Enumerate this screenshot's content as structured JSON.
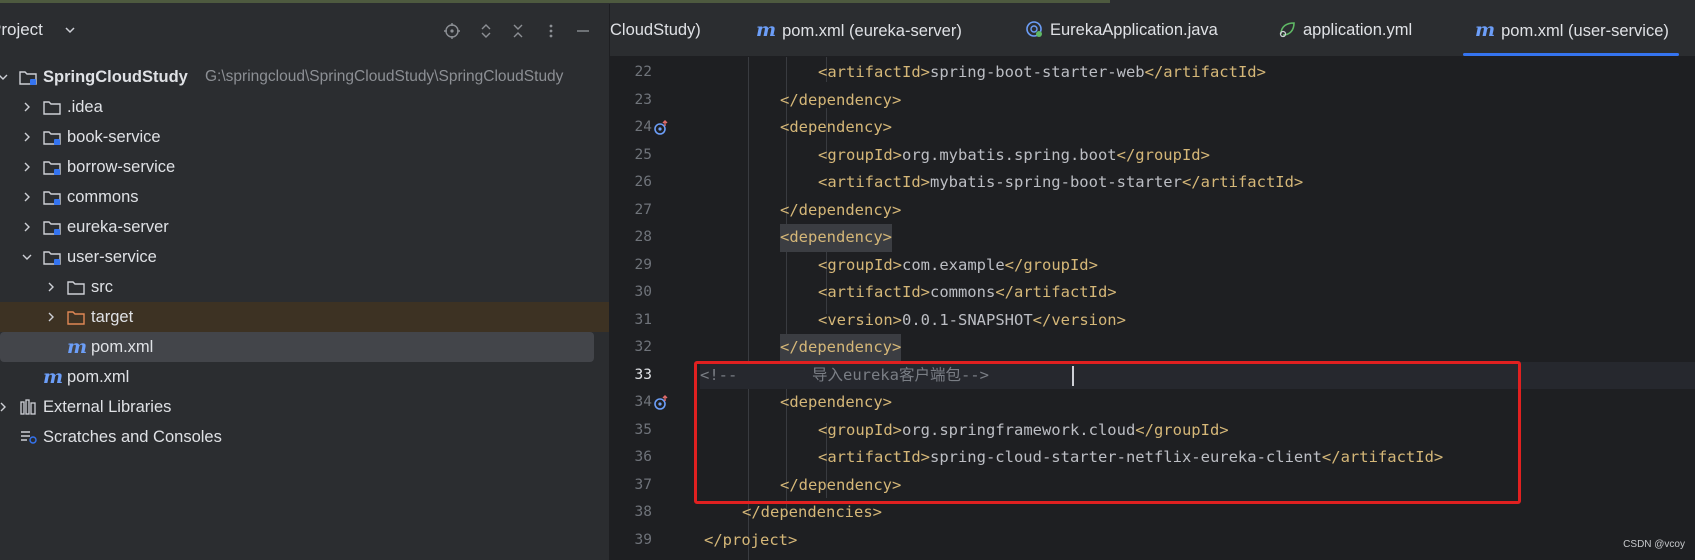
{
  "project_panel": {
    "title": "Project",
    "tree": [
      {
        "label": "SpringCloudStudy",
        "path": "G:\\springcloud\\SpringCloudStudy\\SpringCloudStudy",
        "icon": "module-folder-icon",
        "expanded": true
      },
      {
        "label": ".idea",
        "icon": "folder-icon",
        "expanded": false
      },
      {
        "label": "book-service",
        "icon": "module-folder-icon",
        "expanded": false
      },
      {
        "label": "borrow-service",
        "icon": "module-folder-icon",
        "expanded": false
      },
      {
        "label": "commons",
        "icon": "module-folder-icon",
        "expanded": false
      },
      {
        "label": "eureka-server",
        "icon": "module-folder-icon",
        "expanded": false
      },
      {
        "label": "user-service",
        "icon": "module-folder-icon",
        "expanded": true
      },
      {
        "label": "src",
        "icon": "folder-icon",
        "expanded": false
      },
      {
        "label": "target",
        "icon": "excluded-folder-icon",
        "expanded": false
      },
      {
        "label": "pom.xml",
        "icon": "maven-icon",
        "selected": true
      },
      {
        "label": "pom.xml",
        "icon": "maven-icon"
      },
      {
        "label": "External Libraries",
        "icon": "library-icon",
        "expanded": false
      },
      {
        "label": "Scratches and Consoles",
        "icon": "scratches-icon"
      }
    ]
  },
  "tabs": [
    {
      "label": "CloudStudy)",
      "icon": "maven-icon"
    },
    {
      "label": "pom.xml (eureka-server)",
      "icon": "maven-icon"
    },
    {
      "label": "EurekaApplication.java",
      "icon": "spring-boot-class-icon"
    },
    {
      "label": "application.yml",
      "icon": "spring-config-icon"
    },
    {
      "label": "pom.xml (user-service)",
      "icon": "maven-icon",
      "active": true
    }
  ],
  "code_lines": [
    {
      "num": "22",
      "text": "<artifactId>spring-boot-starter-web</artifactId>"
    },
    {
      "num": "23",
      "text": "</dependency>"
    },
    {
      "num": "24",
      "text": "<dependency>"
    },
    {
      "num": "25",
      "text": "<groupId>org.mybatis.spring.boot</groupId>"
    },
    {
      "num": "26",
      "text": "<artifactId>mybatis-spring-boot-starter</artifactId>"
    },
    {
      "num": "27",
      "text": "</dependency>"
    },
    {
      "num": "28",
      "text": "<dependency>"
    },
    {
      "num": "29",
      "text": "<groupId>com.example</groupId>"
    },
    {
      "num": "30",
      "text": "<artifactId>commons</artifactId>"
    },
    {
      "num": "31",
      "text": "<version>0.0.1-SNAPSHOT</version>"
    },
    {
      "num": "32",
      "text": "</dependency>"
    },
    {
      "num": "33",
      "text": "<!--        导入eureka客户端包-->"
    },
    {
      "num": "34",
      "text": "<dependency>"
    },
    {
      "num": "35",
      "text": "<groupId>org.springframework.cloud</groupId>"
    },
    {
      "num": "36",
      "text": "<artifactId>spring-cloud-starter-netflix-eureka-client</artifactId>"
    },
    {
      "num": "37",
      "text": "</dependency>"
    },
    {
      "num": "38",
      "text": "</dependencies>"
    },
    {
      "num": "39",
      "text": "</project>"
    }
  ],
  "watermark": "CSDN @vcoy",
  "colors": {
    "tag": "#d5b778",
    "comment": "#7a7e85",
    "accent": "#3574f0",
    "highlight_box": "#e02020"
  }
}
